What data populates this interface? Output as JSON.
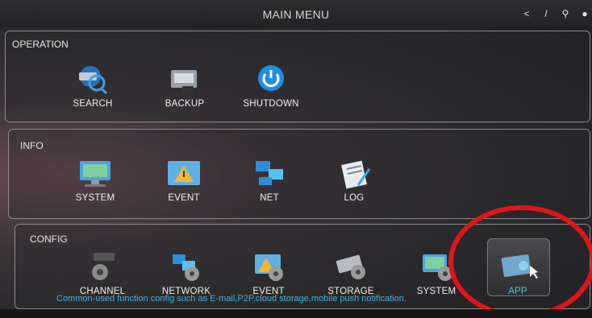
{
  "window": {
    "title": "MAIN MENU"
  },
  "toolbar": {
    "icons": [
      "share-icon",
      "edit-icon",
      "search-icon",
      "info-icon"
    ]
  },
  "sections": {
    "operation": {
      "title": "OPERATION",
      "items": [
        {
          "label": "SEARCH",
          "icon": "camera-search-icon"
        },
        {
          "label": "BACKUP",
          "icon": "backup-icon"
        },
        {
          "label": "SHUTDOWN",
          "icon": "power-icon"
        }
      ]
    },
    "info": {
      "title": "INFO",
      "items": [
        {
          "label": "SYSTEM",
          "icon": "monitor-icon"
        },
        {
          "label": "EVENT",
          "icon": "warning-icon"
        },
        {
          "label": "NET",
          "icon": "network-icon"
        },
        {
          "label": "LOG",
          "icon": "log-icon"
        }
      ]
    },
    "config": {
      "title": "CONFIG",
      "items": [
        {
          "label": "CHANNEL",
          "icon": "camera-gear-icon"
        },
        {
          "label": "NETWORK",
          "icon": "network-gear-icon"
        },
        {
          "label": "EVENT",
          "icon": "warning-gear-icon"
        },
        {
          "label": "STORAGE",
          "icon": "storage-gear-icon"
        },
        {
          "label": "SYSTEM",
          "icon": "monitor-gear-icon"
        },
        {
          "label": "APP",
          "icon": "app-icon"
        }
      ],
      "selected": "APP",
      "description": "Common-used function config such as E-mail,P2P,cloud storage,mobile push notification."
    }
  },
  "colors": {
    "accent": "#3fb3d8",
    "highlight_circle": "#e01515"
  }
}
